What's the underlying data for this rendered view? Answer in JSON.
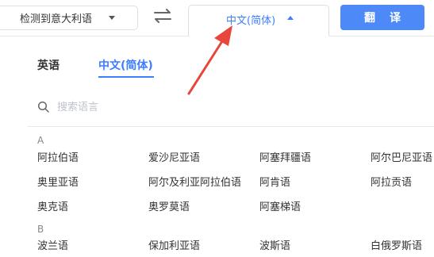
{
  "source_language": {
    "label": "检测到意大利语"
  },
  "target_language": {
    "label": "中文(简体)"
  },
  "translate_button": {
    "label": "翻译"
  },
  "tabs": [
    {
      "label": "英语",
      "active": false
    },
    {
      "label": "中文(简体)",
      "active": true
    }
  ],
  "search": {
    "placeholder": "搜索语言",
    "value": ""
  },
  "groups": [
    {
      "letter": "A",
      "languages": [
        "阿拉伯语",
        "爱沙尼亚语",
        "阿塞拜疆语",
        "阿尔巴尼亚语",
        "奥里亚语",
        "阿尔及利亚阿拉伯语",
        "阿肯语",
        "阿拉贡语",
        "奥克语",
        "奥罗莫语",
        "阿塞梯语"
      ]
    },
    {
      "letter": "B",
      "languages": [
        "波兰语",
        "保加利亚语",
        "波斯语",
        "白俄罗斯语"
      ]
    }
  ],
  "colors": {
    "accent": "#3d7eff",
    "button": "#4e8af7",
    "arrow": "#e8453c"
  }
}
